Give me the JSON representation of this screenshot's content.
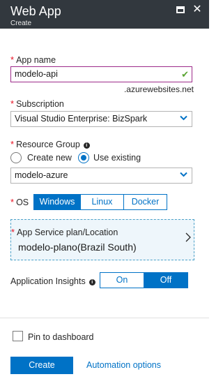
{
  "header": {
    "title": "Web App",
    "subtitle": "Create",
    "maximize_icon": "maximize-icon",
    "close_icon": "close-icon",
    "background_color": "#32383e"
  },
  "app_name": {
    "label": "App name",
    "value": "modelo-api",
    "suffix": ".azurewebsites.net",
    "valid_icon": "check-icon"
  },
  "subscription": {
    "label": "Subscription",
    "selected": "Visual Studio Enterprise: BizSpark"
  },
  "resource_group": {
    "label": "Resource Group",
    "options": [
      {
        "label": "Create new",
        "selected": false
      },
      {
        "label": "Use existing",
        "selected": true
      }
    ],
    "selected": "modelo-azure"
  },
  "os": {
    "label": "OS",
    "options": [
      {
        "label": "Windows",
        "selected": true
      },
      {
        "label": "Linux",
        "selected": false
      },
      {
        "label": "Docker",
        "selected": false
      }
    ]
  },
  "service_plan": {
    "label": "App Service plan/Location",
    "value": "modelo-plano(Brazil South)"
  },
  "insights": {
    "label": "Application Insights",
    "on_label": "On",
    "off_label": "Off",
    "selected": "Off"
  },
  "footer": {
    "pin_label": "Pin to dashboard",
    "pin_checked": false,
    "create_label": "Create",
    "automation_label": "Automation options"
  },
  "colors": {
    "accent": "#0072c6",
    "required": "#e81123",
    "valid": "#5aa532",
    "focus_border": "#9d2a8a"
  }
}
